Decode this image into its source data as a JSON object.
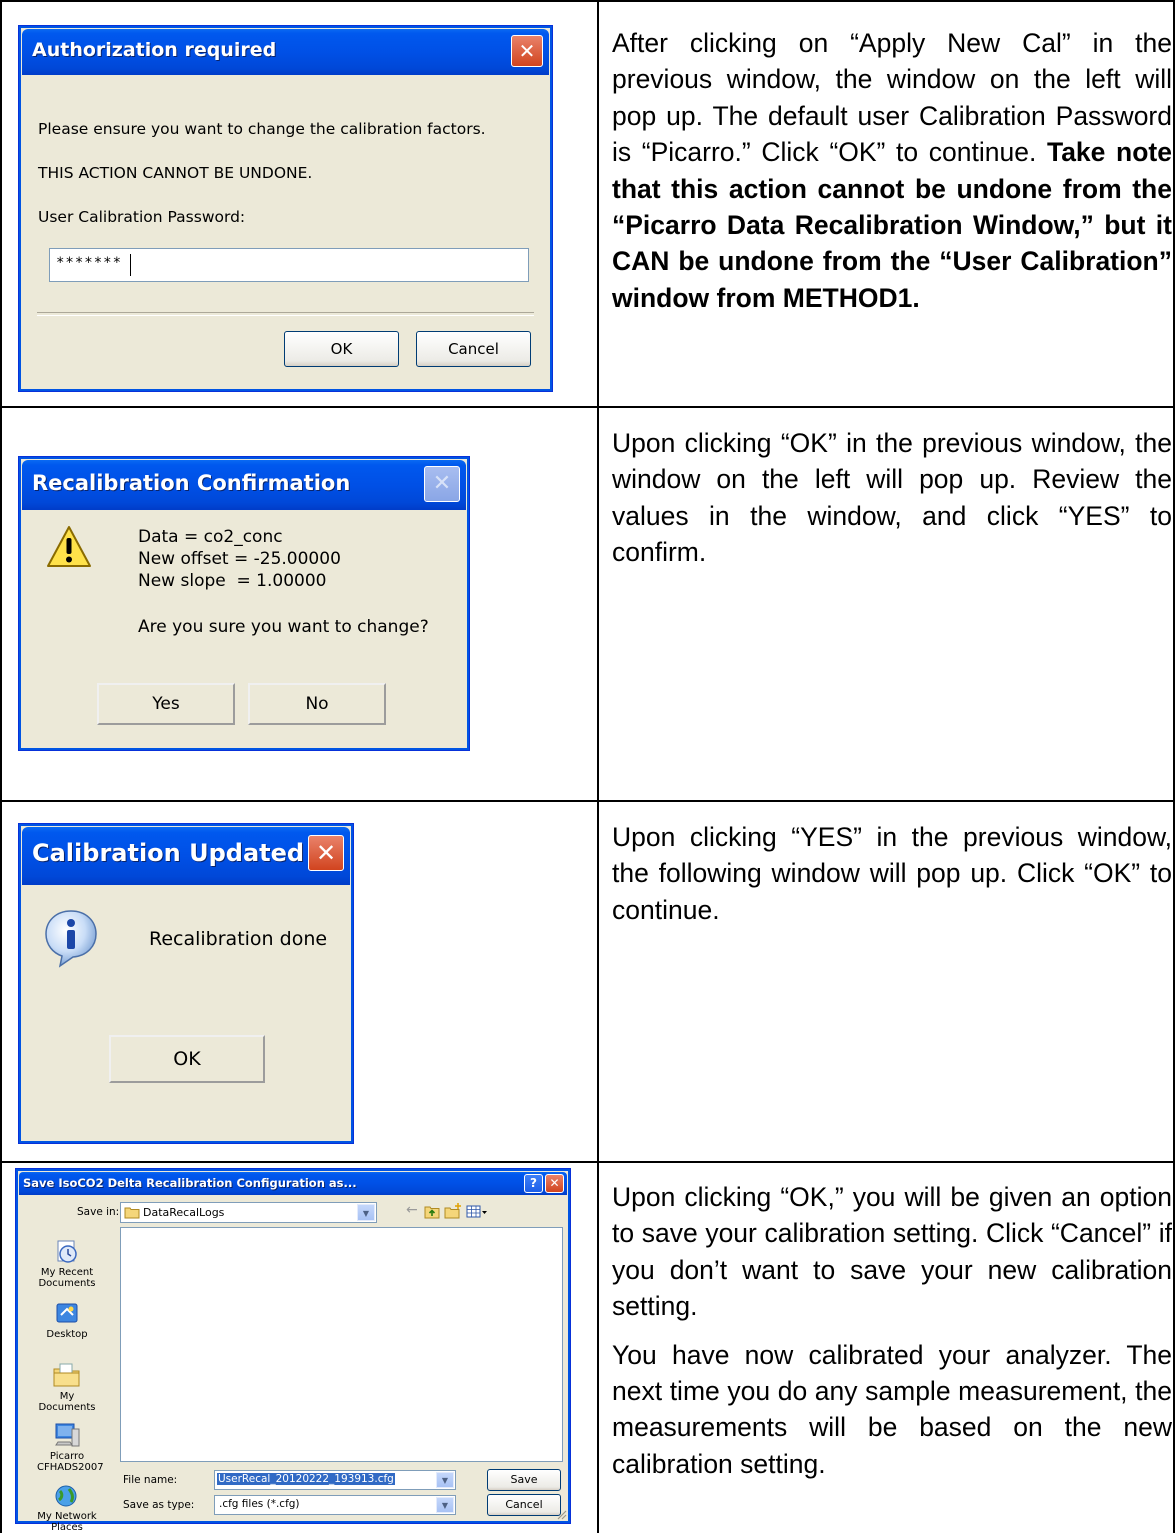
{
  "dialogs": {
    "auth": {
      "title": "Authorization required",
      "line1": "Please ensure you want to change the calibration factors.",
      "line2": "THIS ACTION CANNOT BE UNDONE.",
      "line3": "User Calibration Password:",
      "password_value": "*******",
      "ok_label": "OK",
      "cancel_label": "Cancel",
      "close_glyph": "✕"
    },
    "confirm": {
      "title": "Recalibration Confirmation",
      "data_line": "Data = co2_conc",
      "offset_line": "New offset = -25.00000",
      "slope_line": "New slope  = 1.00000",
      "question": "Are you sure you want to change?",
      "yes_label": "Yes",
      "no_label": "No",
      "close_glyph": "✕"
    },
    "updated": {
      "title": "Calibration Updated",
      "message": "Recalibration done",
      "ok_label": "OK",
      "close_glyph": "✕"
    },
    "save": {
      "title": "Save IsoCO2 Delta Recalibration Configuration as...",
      "save_in_label": "Save in:",
      "save_in_value": "DataRecalLogs",
      "places": [
        "My Recent Documents",
        "Desktop",
        "My Documents",
        "Picarro CFHADS2007",
        "My Network Places"
      ],
      "file_name_label": "File name:",
      "file_name_value": "UserRecal_20120222_193913.cfg",
      "save_type_label": "Save as type:",
      "save_type_value": ".cfg files (*.cfg)",
      "save_label": "Save",
      "cancel_label": "Cancel",
      "help_glyph": "?",
      "close_glyph": "✕"
    }
  },
  "descriptions": {
    "row1_plain": "After clicking on “Apply New Cal” in the previous window, the window on the left will pop up. The default user Calibration Password is “Picarro.” Click “OK” to continue.  ",
    "row1_bold": "Take note that this action cannot be undone from the “Picarro Data Recalibration Window,” but it CAN be undone from the “User Calibration” window from METHOD1.",
    "row2": "Upon clicking “OK” in the previous window, the window on the left will pop up.  Review the values in the window, and click “YES” to confirm.",
    "row3": "Upon clicking “YES” in the previous window, the following window will pop up. Click “OK” to continue.",
    "row4_p1": "Upon clicking “OK,” you will be given an option to save your calibration setting. Click “Cancel” if you don’t want to save your new calibration setting.",
    "row4_p2": "You have now calibrated your analyzer. The next time you do any sample measurement, the measurements will be based on the new calibration setting."
  }
}
